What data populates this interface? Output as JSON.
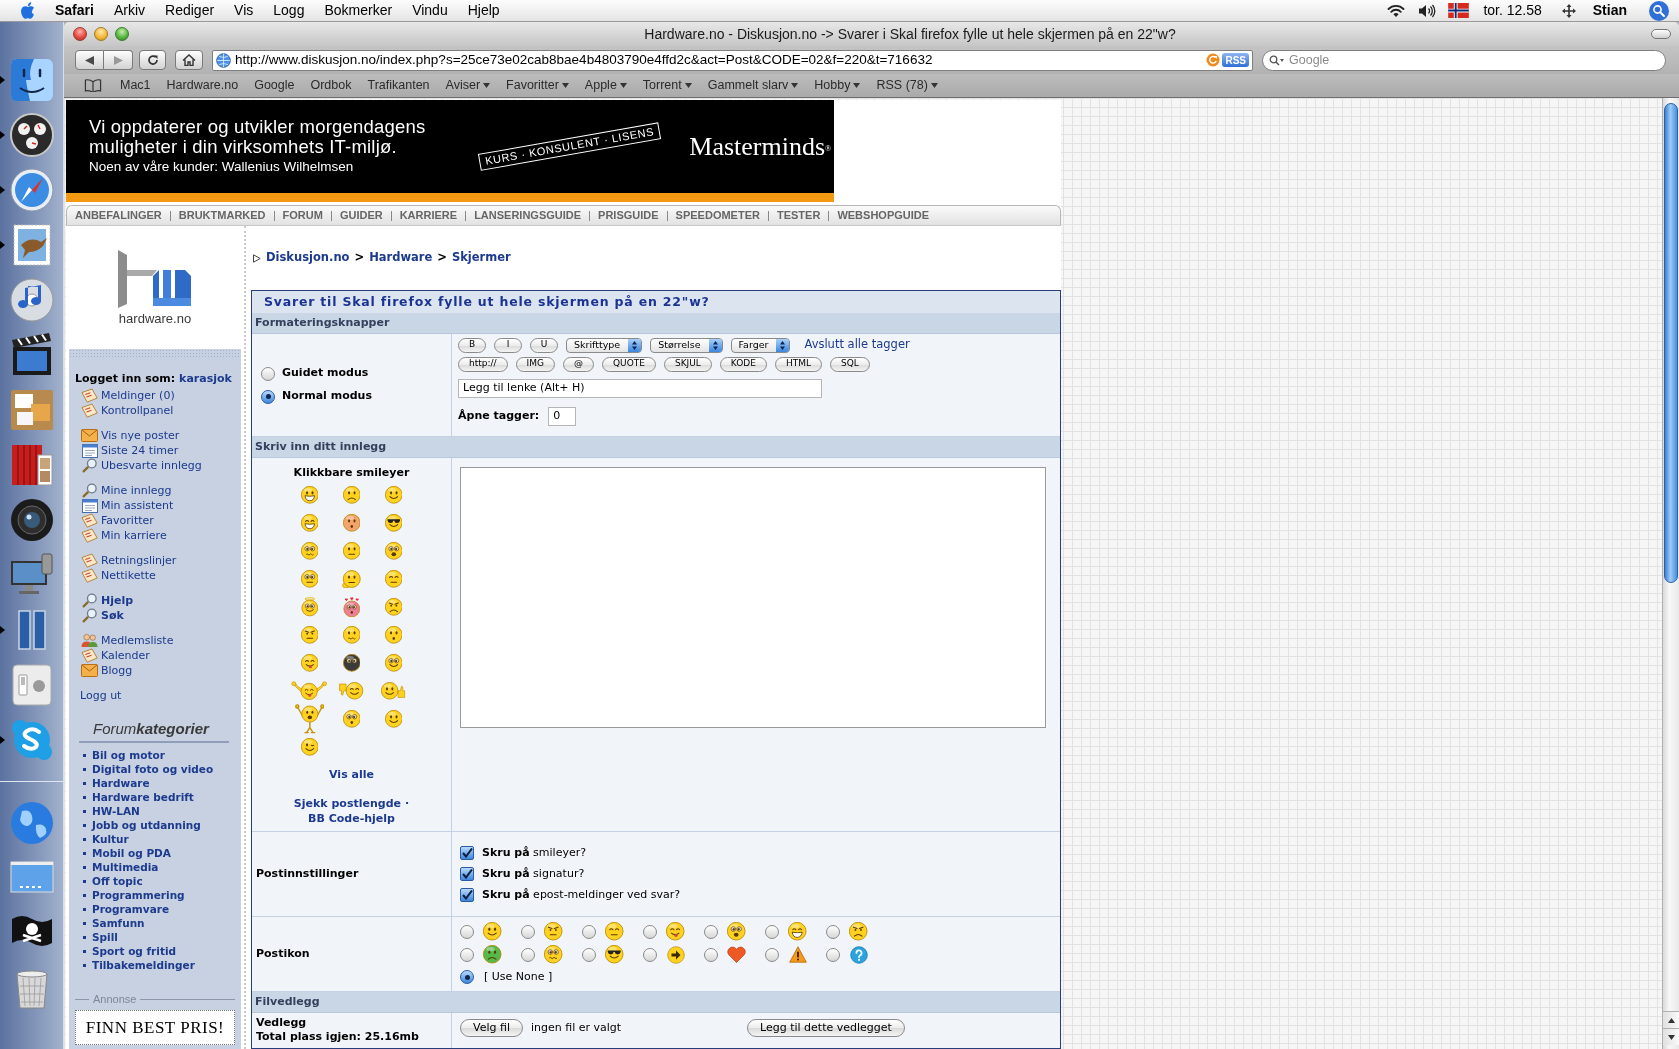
{
  "menu_bar": {
    "app": "Safari",
    "menus": [
      "Arkiv",
      "Rediger",
      "Vis",
      "Logg",
      "Bokmerker",
      "Vindu",
      "Hjelp"
    ],
    "clock": "tor. 12.58",
    "user": "Stian"
  },
  "dock": {
    "apps": [
      {
        "kind": "face",
        "running": true
      },
      {
        "kind": "gauge",
        "running": true
      },
      {
        "kind": "compass",
        "running": true
      },
      {
        "kind": "stamp",
        "running": true
      },
      {
        "kind": "disc",
        "running": false
      },
      {
        "kind": "clapper",
        "running": false
      },
      {
        "kind": "collage",
        "running": false
      },
      {
        "kind": "curtain",
        "running": false
      },
      {
        "kind": "lens",
        "running": false
      },
      {
        "kind": "monitor",
        "running": false
      },
      {
        "kind": "panels",
        "running": true
      },
      {
        "kind": "switch",
        "running": false
      },
      {
        "kind": "chat",
        "running": true
      }
    ],
    "stacks": [
      {
        "kind": "globe"
      },
      {
        "kind": "desktop"
      },
      {
        "kind": "flag"
      },
      {
        "kind": "trash"
      }
    ]
  },
  "browser": {
    "title": "Hardware.no - Diskusjon.no -> Svarer i Skal firefox fylle ut hele skjermen på en 22\"w?",
    "url": "http://www.diskusjon.no/index.php?s=25ce73e02cab8bae4b4803790e4ffd2c&act=Post&CODE=02&f=220&t=716632",
    "rss": "RSS",
    "search": {
      "placeholder": "Google"
    },
    "bookmarks": [
      {
        "kind": "link",
        "label": "Mac1"
      },
      {
        "kind": "link",
        "label": "Hardware.no"
      },
      {
        "kind": "link",
        "label": "Google"
      },
      {
        "kind": "link",
        "label": "Ordbok"
      },
      {
        "kind": "link",
        "label": "Trafikanten"
      },
      {
        "kind": "folder",
        "label": "Aviser"
      },
      {
        "kind": "folder",
        "label": "Favoritter"
      },
      {
        "kind": "folder",
        "label": "Apple"
      },
      {
        "kind": "folder",
        "label": "Torrent"
      },
      {
        "kind": "folder",
        "label": "Gammelt slarv"
      },
      {
        "kind": "folder",
        "label": "Hobby"
      },
      {
        "kind": "folder",
        "label": "RSS (78)"
      }
    ]
  },
  "ad": {
    "lines": [
      "Vi oppdaterer og utvikler morgendagens",
      "muligheter i din virksomhets IT-miljø."
    ],
    "customers": "Noen av våre kunder: Wallenius Wilhelmsen",
    "stamp": "KURS · KONSULENT · LISENS",
    "brand": "Masterminds$^{®}$"
  },
  "nav": [
    "ANBEFALINGER",
    "BRUKTMARKED",
    "FORUM",
    "GUIDER",
    "KARRIERE",
    "LANSERINGSGUIDE",
    "PRISGUIDE",
    "SPEEDOMETER",
    "TESTER",
    "WEBSHOPGUIDE"
  ],
  "sidebar": {
    "logo_text": "hardware.no",
    "login_label": "Logget inn som:",
    "username": "karasjok",
    "groups": [
      {
        "items": [
          {
            "kind": "note",
            "label": "Meldinger (0)",
            "bold": false
          },
          {
            "kind": "note",
            "label": "Kontrollpanel",
            "bold": false
          }
        ]
      },
      {
        "items": [
          {
            "kind": "mail",
            "label": "Vis nye poster",
            "bold": false
          },
          {
            "kind": "window",
            "label": "Siste 24 timer",
            "bold": false
          },
          {
            "kind": "search",
            "label": "Ubesvarte innlegg",
            "bold": false
          }
        ]
      },
      {
        "items": [
          {
            "kind": "search",
            "label": "Mine innlegg",
            "bold": false
          },
          {
            "kind": "window",
            "label": "Min assistent",
            "bold": false
          },
          {
            "kind": "note",
            "label": "Favoritter",
            "bold": false
          },
          {
            "kind": "note",
            "label": "Min karriere",
            "bold": false
          }
        ]
      },
      {
        "items": [
          {
            "kind": "note",
            "label": "Retningslinjer",
            "bold": false
          },
          {
            "kind": "note",
            "label": "Nettikette",
            "bold": false
          }
        ]
      },
      {
        "items": [
          {
            "kind": "search",
            "label": "Hjelp",
            "bold": true
          },
          {
            "kind": "search",
            "label": "Søk",
            "bold": true
          }
        ]
      },
      {
        "items": [
          {
            "kind": "people",
            "label": "Medlemsliste",
            "bold": false
          },
          {
            "kind": "note",
            "label": "Kalender",
            "bold": false
          },
          {
            "kind": "mail",
            "label": "Blogg",
            "bold": false
          }
        ]
      }
    ],
    "logout": "Logg ut",
    "categories_title": "Forum**kategorier**",
    "categories": [
      "Bil og motor",
      "Digital foto og video",
      "Hardware",
      "Hardware bedrift",
      "HW-LAN",
      "Jobb og utdanning",
      "Kultur",
      "Mobil og PDA",
      "Multimedia",
      "Off topic",
      "Programmering",
      "Programvare",
      "Samfunn",
      "Spill",
      "Sport og fritid",
      "Tilbakemeldinger"
    ],
    "ad_label": "Annonse",
    "ad_text": "FINN BEST PRIS!"
  },
  "breadcrumb": [
    {
      "kind": "link",
      "text": "Diskusjon.no"
    },
    {
      "kind": "separator",
      "text": ">"
    },
    {
      "kind": "link",
      "text": "Hardware"
    },
    {
      "kind": "separator",
      "text": ">"
    },
    {
      "kind": "link",
      "text": "Skjermer"
    }
  ],
  "form": {
    "title": "Svarer til Skal firefox fylle ut hele skjermen på en 22\"w?",
    "formatting": {
      "header": "Formateringsknapper",
      "modes": [
        {
          "label": "Guidet modus",
          "selected": false
        },
        {
          "label": "Normal modus",
          "selected": true
        }
      ],
      "tag_buttons": [
        "B",
        "I",
        "U"
      ],
      "selects": [
        "Skrifttype",
        "Størrelse",
        "Farger"
      ],
      "close_tags": "Avslutt alle tagger",
      "code_buttons": [
        "http://",
        "IMG",
        "@",
        "QUOTE",
        "SKJUL",
        "KODE",
        "HTML",
        "SQL"
      ],
      "help_field": {
        "value": "Legg til lenke (Alt+ H)"
      },
      "open_tags": {
        "label": "Åpne tagger:",
        "value": "0"
      }
    },
    "compose": {
      "header": "Skriv inn ditt innlegg",
      "smileys_title": "Klikkbare smileyer",
      "smileys": [
        {
          "kind": "grin"
        },
        {
          "kind": "sad"
        },
        {
          "kind": "smile"
        },
        {
          "kind": "laugh"
        },
        {
          "kind": "blush"
        },
        {
          "kind": "cool"
        },
        {
          "kind": "worried"
        },
        {
          "kind": "neutral"
        },
        {
          "kind": "shocked"
        },
        {
          "kind": "dizzy"
        },
        {
          "kind": "thinking"
        },
        {
          "kind": "sleepy"
        },
        {
          "kind": "angel"
        },
        {
          "kind": "love"
        },
        {
          "kind": "angry"
        },
        {
          "kind": "annoyed"
        },
        {
          "kind": "unsure"
        },
        {
          "kind": "surprised"
        },
        {
          "kind": "tongue"
        },
        {
          "kind": "ninja"
        },
        {
          "kind": "nerd"
        },
        {
          "kind": "cheer"
        },
        {
          "kind": "thumbsdown"
        },
        {
          "kind": "thumbsup"
        },
        {
          "kind": "hooray"
        },
        {
          "kind": "whistle"
        },
        {
          "kind": "smile"
        },
        {
          "kind": "wink"
        }
      ],
      "show_all": "Vis alle",
      "links": [
        "Sjekk postlengde",
        "BB Code-hjelp"
      ],
      "link_separator": "·"
    },
    "options": {
      "label": "Postinnstillinger",
      "items": [
        {
          "text": "**Skru på** smileyer?",
          "checked": true
        },
        {
          "text": "**Skru på** signatur?",
          "checked": true
        },
        {
          "text": "**Skru på** epost-meldinger ved svar?",
          "checked": true
        }
      ]
    },
    "post_icons": {
      "label": "Postikon",
      "icons": [
        {
          "kind": "smile",
          "selected": false
        },
        {
          "kind": "annoyed",
          "selected": false
        },
        {
          "kind": "sleepy",
          "selected": false
        },
        {
          "kind": "tongue",
          "selected": false
        },
        {
          "kind": "shocked",
          "selected": false
        },
        {
          "kind": "laugh",
          "selected": false
        },
        {
          "kind": "angry",
          "selected": false
        },
        {
          "kind": "sick",
          "selected": false
        },
        {
          "kind": "confused",
          "selected": false
        },
        {
          "kind": "cool",
          "selected": false
        },
        {
          "kind": "arrow",
          "selected": false
        },
        {
          "kind": "heart",
          "selected": false
        },
        {
          "kind": "warning",
          "selected": false
        },
        {
          "kind": "question",
          "selected": false
        }
      ],
      "none": {
        "text": "[ Use None ]",
        "selected": true
      }
    },
    "attachments": {
      "header": "Filvedlegg",
      "label": "Vedlegg",
      "quota": "Total plass igjen: 25.16mb",
      "choose_button": "Velg fil",
      "file_status": "ingen fil er valgt",
      "add_button": "Legg til dette vedlegget"
    }
  }
}
